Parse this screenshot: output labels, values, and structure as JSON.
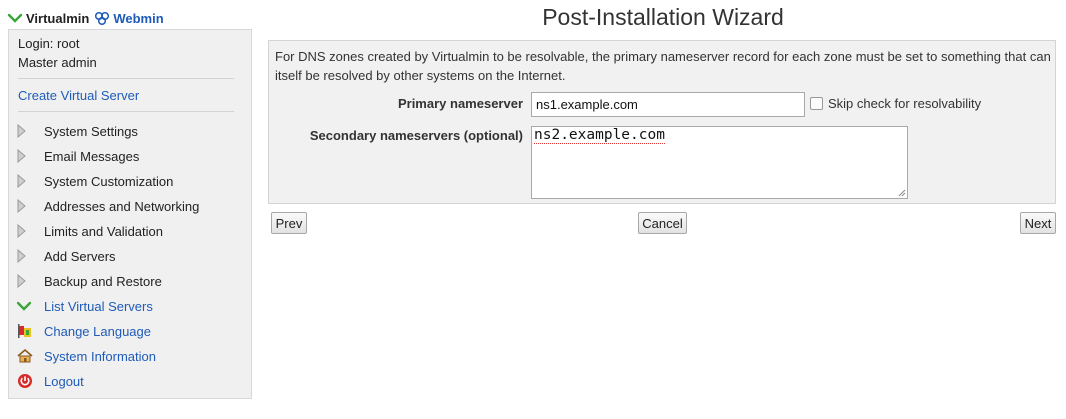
{
  "header": {
    "virtualmin_label": "Virtualmin",
    "webmin_label": "Webmin"
  },
  "sidebar": {
    "login": "Login: root",
    "role": "Master admin",
    "create_link": "Create Virtual Server",
    "items": [
      {
        "label": "System Settings",
        "icon": "triangle-right-icon"
      },
      {
        "label": "Email Messages",
        "icon": "triangle-right-icon"
      },
      {
        "label": "System Customization",
        "icon": "triangle-right-icon"
      },
      {
        "label": "Addresses and Networking",
        "icon": "triangle-right-icon"
      },
      {
        "label": "Limits and Validation",
        "icon": "triangle-right-icon"
      },
      {
        "label": "Add Servers",
        "icon": "triangle-right-icon"
      },
      {
        "label": "Backup and Restore",
        "icon": "triangle-right-icon"
      },
      {
        "label": "List Virtual Servers",
        "icon": "chevron-down-icon"
      },
      {
        "label": "Change Language",
        "icon": "flags-icon"
      },
      {
        "label": "System Information",
        "icon": "home-icon"
      },
      {
        "label": "Logout",
        "icon": "power-icon"
      }
    ]
  },
  "main": {
    "title": "Post-Installation Wizard",
    "description": "For DNS zones created by Virtualmin to be resolvable, the primary nameserver record for each zone must be set to something that can itself be resolved by other systems on the Internet.",
    "primary_label": "Primary nameserver",
    "primary_value": "ns1.example.com",
    "skip_label": "Skip check for resolvability",
    "skip_checked": false,
    "secondary_label": "Secondary nameservers (optional)",
    "secondary_value": "ns2.example.com",
    "buttons": {
      "prev": "Prev",
      "cancel": "Cancel",
      "next": "Next"
    }
  },
  "colors": {
    "link": "#1e5bb8",
    "chevron_green": "#3aa63a",
    "panel_bg": "#f1f1f1",
    "logout_red": "#d62b2b"
  }
}
